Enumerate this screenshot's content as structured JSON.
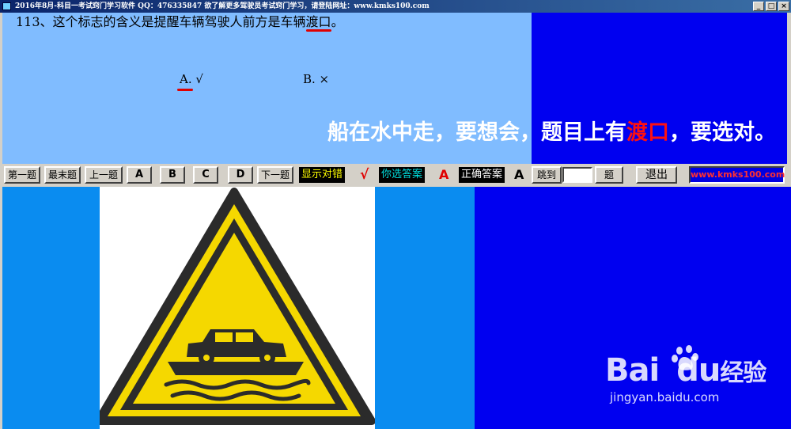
{
  "window": {
    "title": "2016年8月-科目一考试窍门学习软件  QQ：476335847 欲了解更多驾驶员考试窍门学习，请登陆网址：www.kmks100.com",
    "controls": [
      "_",
      "□",
      "×"
    ]
  },
  "question": {
    "text_before": "113、这个标志的含义是提醒车辆驾驶人前方是车辆",
    "keyword": "渡口",
    "text_after": "。",
    "option_a": "A. √",
    "option_b": "B. ×"
  },
  "mnemonic": {
    "before": "船在水中走，要想会，题目上有",
    "keyword": "渡口",
    "after": "，要选对。"
  },
  "toolbar": {
    "first": "第一题",
    "last": "最末题",
    "prev": "上一题",
    "a": "A",
    "b": "B",
    "c": "C",
    "d": "D",
    "next": "下一题",
    "show_result": "显示对错",
    "result_mark": "√",
    "your_answer_label": "你选答案",
    "your_answer": "A",
    "correct_answer_label": "正确答案",
    "correct_answer": "A",
    "jump": "跳到",
    "jump_value": "",
    "question_suffix": "题",
    "exit": "退出",
    "site": "www.kmks100.com"
  },
  "watermark": {
    "logo": "Bai",
    "logo_tail": "du",
    "logo_cn": "经验",
    "url": "jingyan.baidu.com"
  },
  "colors": {
    "question_bg": "#80bcff",
    "dark_blue": "#0000f0",
    "light_blue": "#0a8cf0",
    "highlight_red": "#e00000",
    "sign_yellow": "#f5d800"
  },
  "icons": [
    "ferry-warning-sign",
    "baidu-paw-icon"
  ]
}
